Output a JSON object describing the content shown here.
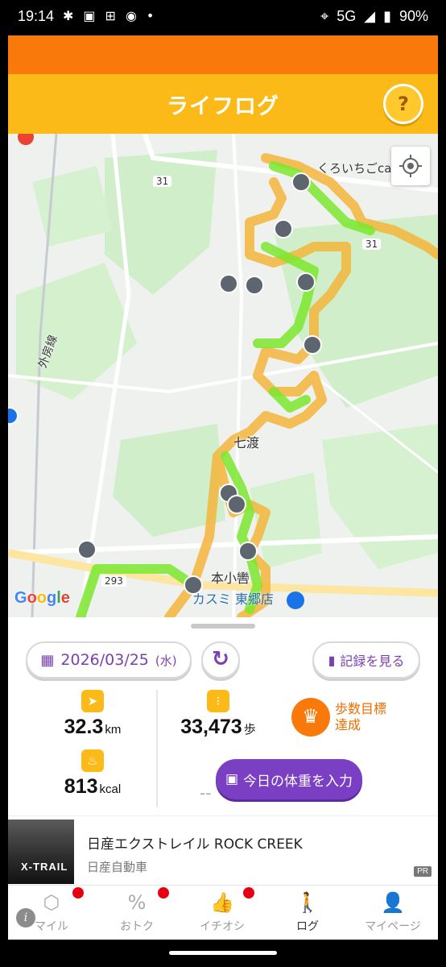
{
  "status_bar": {
    "time": "19:14",
    "network": "5G",
    "battery": "90%"
  },
  "header": {
    "title": "ライフログ",
    "help_label": "?"
  },
  "map": {
    "labels": {
      "shop_top": "くろいちごca",
      "road_31_a": "31",
      "road_31_b": "31",
      "area_nanawatari": "七渡",
      "area_honkoshiki": "本小轡",
      "road_293": "293",
      "store": "カスミ 東郷店",
      "line_left": "外房線"
    },
    "google_logo": [
      "G",
      "o",
      "o",
      "g",
      "l",
      "e"
    ]
  },
  "panel": {
    "date": "2026/03/25",
    "day_of_week": "(水)",
    "records_label": "記録を見る",
    "distance": {
      "value": "32.3",
      "unit": "km"
    },
    "steps": {
      "value": "33,473",
      "unit": "歩"
    },
    "goal": {
      "line1": "歩数目標",
      "line2": "達成"
    },
    "calories": {
      "value": "813",
      "unit": "kcal"
    },
    "weight_dash": "--",
    "bodyfat_dash": "--",
    "weight_button": "今日の体重を入力"
  },
  "ad": {
    "title": "日産エクストレイル ROCK CREEK",
    "advertiser": "日産自動車",
    "badge": "PR",
    "image_text": "X-TRAIL"
  },
  "nav": {
    "items": [
      {
        "label": "マイル",
        "icon": "hexagon-icon"
      },
      {
        "label": "おトク",
        "icon": "coupon-icon"
      },
      {
        "label": "イチオシ",
        "icon": "thumbs-up-icon"
      },
      {
        "label": "ログ",
        "icon": "walker-icon"
      },
      {
        "label": "マイページ",
        "icon": "person-icon"
      }
    ]
  },
  "colors": {
    "header_orange": "#f97a0a",
    "header_yellow": "#fbba17",
    "accent_purple": "#7b3fc4",
    "route_green": "#7be82e",
    "route_orange": "#f5b53c"
  }
}
